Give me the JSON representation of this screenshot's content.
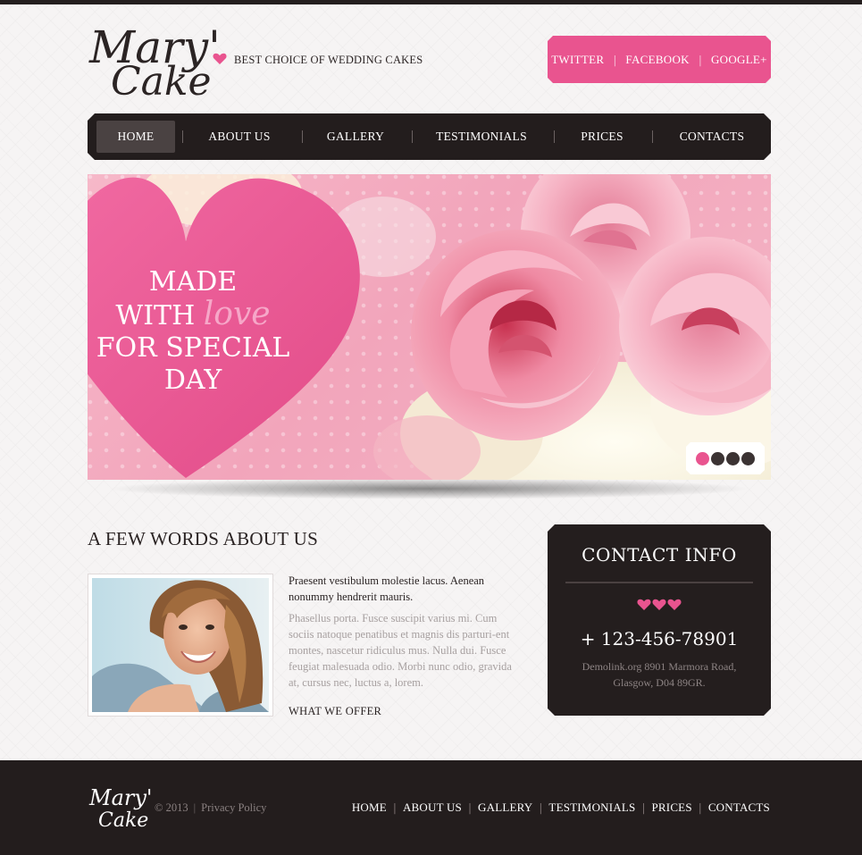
{
  "brand": {
    "logo_line1": "Mary's",
    "logo_line2": "Cake",
    "tagline": "BEST CHOICE OF WEDDING CAKES"
  },
  "social": {
    "twitter": "TWITTER",
    "facebook": "FACEBOOK",
    "google": "GOOGLE+"
  },
  "nav": {
    "items": [
      "HOME",
      "ABOUT US",
      "GALLERY",
      "TESTIMONIALS",
      "PRICES",
      "CONTACTS"
    ],
    "active": "HOME"
  },
  "slider": {
    "line1": "MADE",
    "line2_a": "WITH",
    "line2_b": "love",
    "line3": "FOR SPECIAL",
    "line4": "DAY",
    "slide_count": 4,
    "active_slide": 1
  },
  "about": {
    "title": "A FEW WORDS ABOUT US",
    "lead": "Praesent vestibulum molestie lacus. Aenean nonummy hendrerit mauris.",
    "body": "Phasellus porta. Fusce suscipit varius mi. Cum sociis natoque penatibus et magnis dis parturi-ent montes, nascetur ridiculus mus. Nulla dui. Fusce feugiat  malesuada odio. Morbi nunc odio, gravida at, cursus nec, luctus a, lorem.",
    "link": "WHAT WE OFFER"
  },
  "contact": {
    "title": "CONTACT INFO",
    "phone": "+ 123-456-78901",
    "address": "Demolink.org 8901 Marmora Road, Glasgow, D04 89GR."
  },
  "footer": {
    "copyright": "© 2013",
    "privacy": "Privacy Policy",
    "nav": [
      "HOME",
      "ABOUT US",
      "GALLERY",
      "TESTIMONIALS",
      "PRICES",
      "CONTACTS"
    ]
  },
  "colors": {
    "accent_pink": "#e9548f",
    "dark": "#241e1e",
    "light_bg": "#f6f4f4"
  }
}
